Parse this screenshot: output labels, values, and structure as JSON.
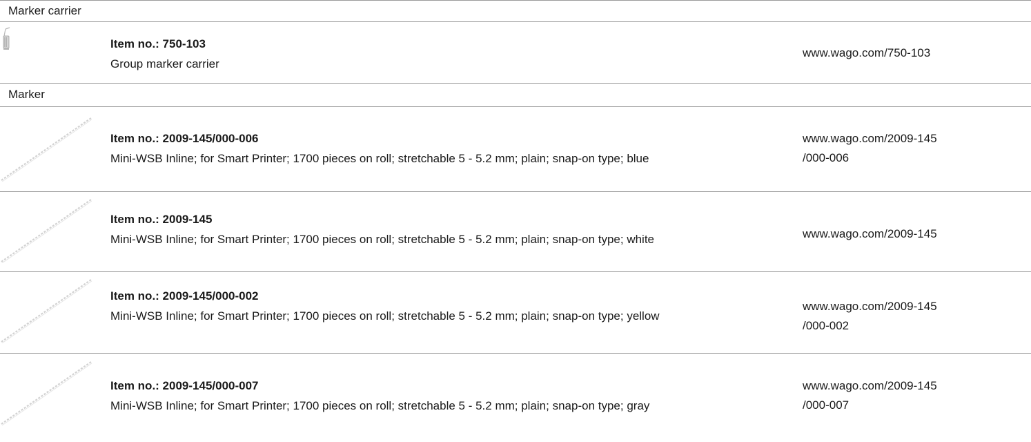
{
  "sections": [
    {
      "label": "Marker carrier",
      "items": [
        {
          "item_no": "Item no.: 750-103",
          "description": "Group marker carrier",
          "url_lines": [
            "www.wago.com/750-103"
          ],
          "icon": "marker-carrier-icon"
        }
      ]
    },
    {
      "label": "Marker",
      "items": [
        {
          "item_no": "Item no.: 2009-145/000-006",
          "description": "Mini-WSB Inline; for Smart Printer; 1700 pieces on roll; stretchable 5 - 5.2 mm; plain; snap-on type; blue",
          "url_lines": [
            "www.wago.com/2009-145",
            "/000-006"
          ],
          "icon": "marker-strip-icon"
        },
        {
          "item_no": "Item no.: 2009-145",
          "description": "Mini-WSB Inline; for Smart Printer; 1700 pieces on roll; stretchable 5 - 5.2 mm; plain; snap-on type; white",
          "url_lines": [
            "www.wago.com/2009-145"
          ],
          "icon": "marker-strip-icon"
        },
        {
          "item_no": "Item no.: 2009-145/000-002",
          "description": "Mini-WSB Inline; for Smart Printer; 1700 pieces on roll; stretchable 5 - 5.2 mm; plain; snap-on type; yellow",
          "url_lines": [
            "www.wago.com/2009-145",
            "/000-002"
          ],
          "icon": "marker-strip-icon"
        },
        {
          "item_no": "Item no.: 2009-145/000-007",
          "description": "Mini-WSB Inline; for Smart Printer; 1700 pieces on roll; stretchable 5 - 5.2 mm; plain; snap-on type; gray",
          "url_lines": [
            "www.wago.com/2009-145",
            "/000-007"
          ],
          "icon": "marker-strip-icon"
        }
      ]
    }
  ]
}
